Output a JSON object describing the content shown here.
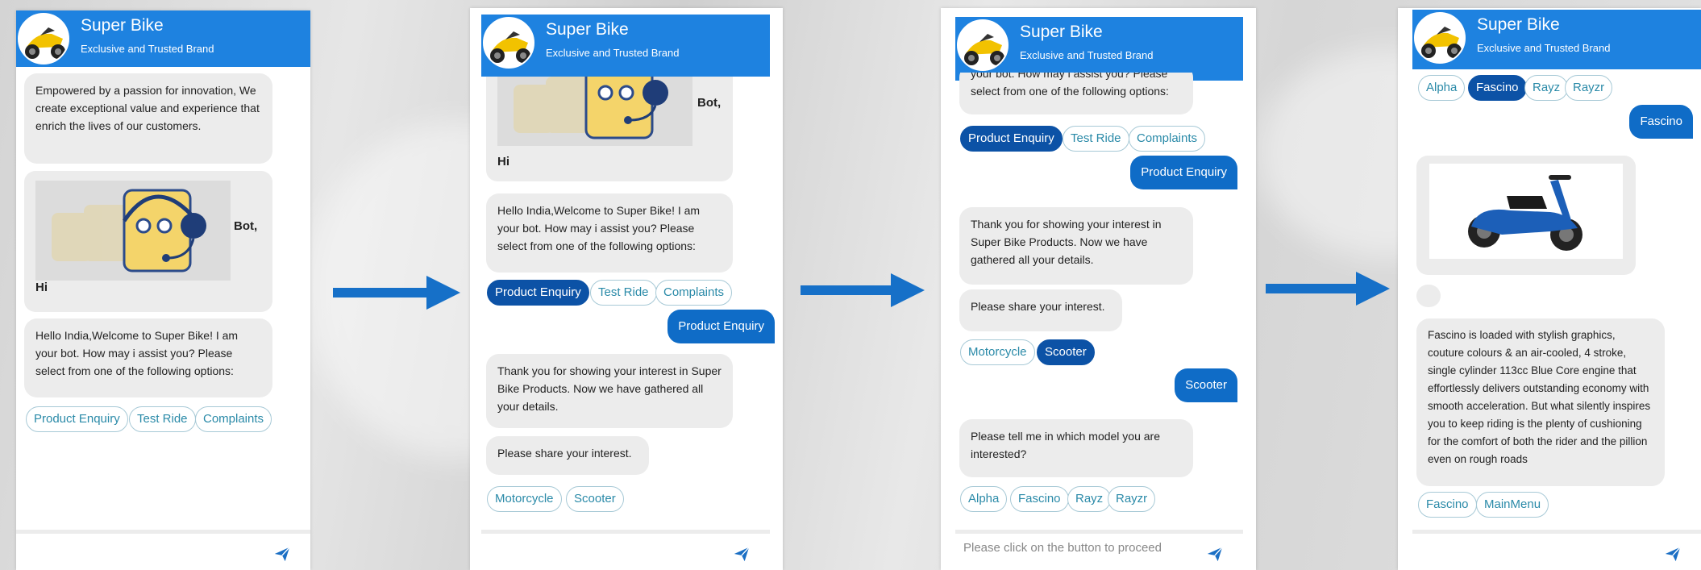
{
  "app": {
    "title": "Super Bike",
    "subtitle": "Exclusive and Trusted Brand"
  },
  "messages": {
    "intro": "Empowered by a passion for innovation, We create exceptional value and experience that enrich the lives of our customers.",
    "bot_label": "Bot,",
    "hi": "Hi",
    "welcome": "Hello India,Welcome to Super Bike! I am your bot. How may i assist you? Please select from one of the following options:",
    "welcome_tail": "your bot. How may i assist you? Please select from one of the following options:",
    "thanks": "Thank you for showing your interest in Super Bike Products. Now we have gathered all your details.",
    "share": "Please share your interest.",
    "model_q": "Please tell me in which model you are interested?",
    "fascino_desc": "Fascino is loaded with stylish graphics, couture colours & an air-cooled, 4 stroke, single cylinder 113cc Blue Core engine that effortlessly delivers outstanding economy with smooth acceleration. But what silently inspires you to keep riding is the plenty of cushioning for the comfort of both the rider and the pillion even on rough roads"
  },
  "options": {
    "main": [
      "Product Enquiry",
      "Test Ride",
      "Complaints"
    ],
    "interest": [
      "Motorcycle",
      "Scooter"
    ],
    "models": [
      "Alpha",
      "Fascino",
      "Rayz",
      "Rayzr"
    ],
    "after": [
      "Fascino",
      "MainMenu"
    ]
  },
  "user": {
    "product": "Product Enquiry",
    "scooter": "Scooter",
    "fascino": "Fascino"
  },
  "composer": {
    "placeholder": "Please click on the button to proceed"
  },
  "colors": {
    "header": "#1e82e0",
    "selected": "#0c52a6",
    "user_bubble": "#0f6cc7",
    "chip_text": "#2a8aa8"
  },
  "icons": {
    "send": "send-icon",
    "arrow": "right-arrow-icon"
  }
}
